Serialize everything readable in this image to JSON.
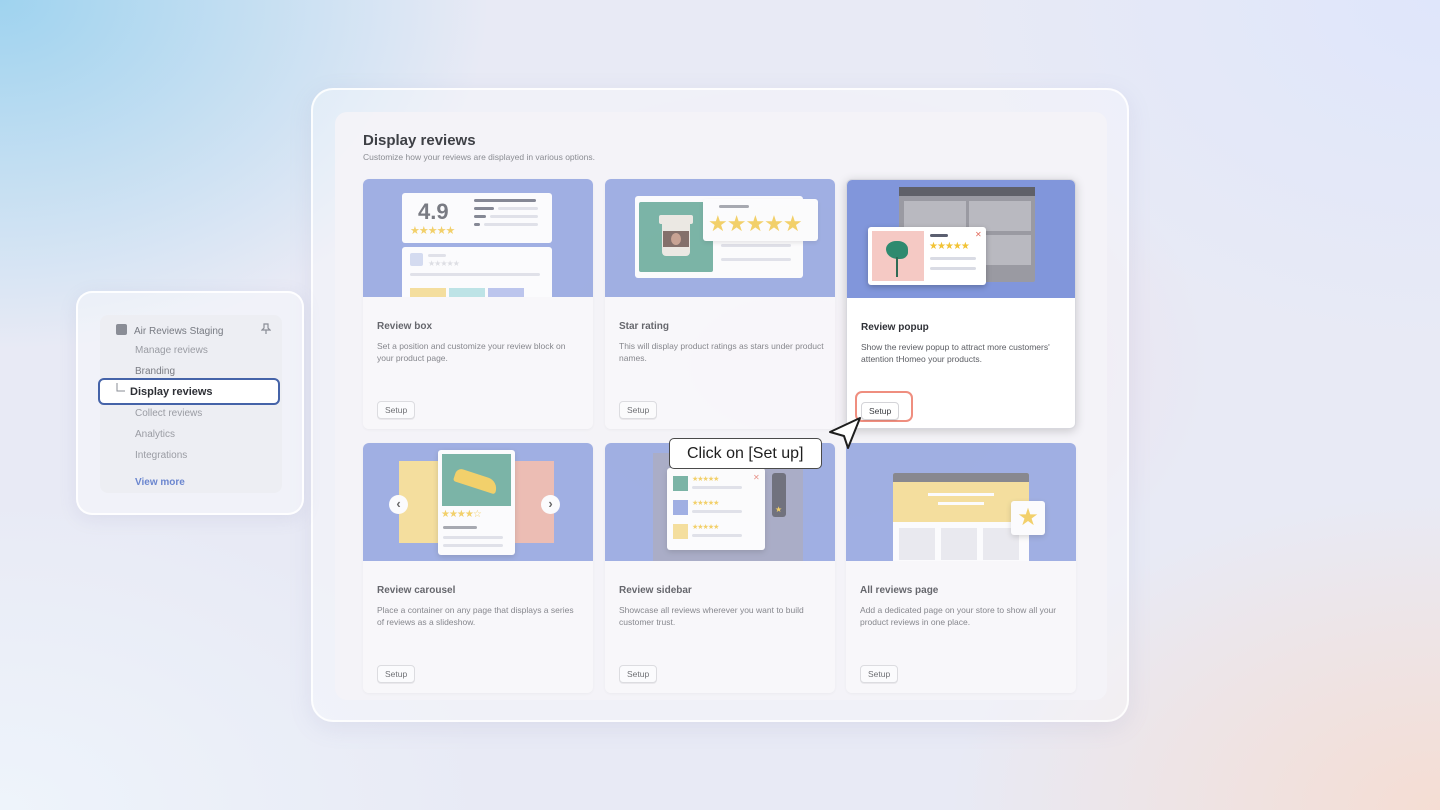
{
  "page": {
    "title": "Display reviews",
    "subtitle": "Customize how your reviews are displayed in various options."
  },
  "cards": [
    {
      "title": "Review box",
      "description": "Set a position and customize your review block on your product page.",
      "button": "Setup"
    },
    {
      "title": "Star rating",
      "description": "This will display product ratings as stars under product names.",
      "button": "Setup"
    },
    {
      "title": "Review popup",
      "description": "Show the review popup to attract more customers' attention tHomeo your products.",
      "button": "Setup"
    },
    {
      "title": "Review carousel",
      "description": "Place a container on any page that displays a series of reviews as a slideshow.",
      "button": "Setup"
    },
    {
      "title": "Review sidebar",
      "description": "Showcase all reviews wherever you want to build customer trust.",
      "button": "Setup"
    },
    {
      "title": "All reviews page",
      "description": "Add a dedicated page on your store to show all your product reviews in one place.",
      "button": "Setup"
    }
  ],
  "illustration": {
    "rating_value": "4.9",
    "stars_five": "★★★★★",
    "stars_four": "★★★★☆"
  },
  "tooltip": {
    "text": "Click on [Set up]"
  },
  "sidebar": {
    "app_name": "Air Reviews Staging",
    "items": [
      "Manage reviews",
      "Branding",
      "Display reviews",
      "Collect reviews",
      "Analytics",
      "Integrations"
    ],
    "selected": "Display reviews",
    "view_more": "View more"
  },
  "colors": {
    "card_image_bg": "#8196db",
    "highlight_ring": "#ef8e7f",
    "nav_selection": "#4563a8",
    "star": "#f2c335"
  }
}
